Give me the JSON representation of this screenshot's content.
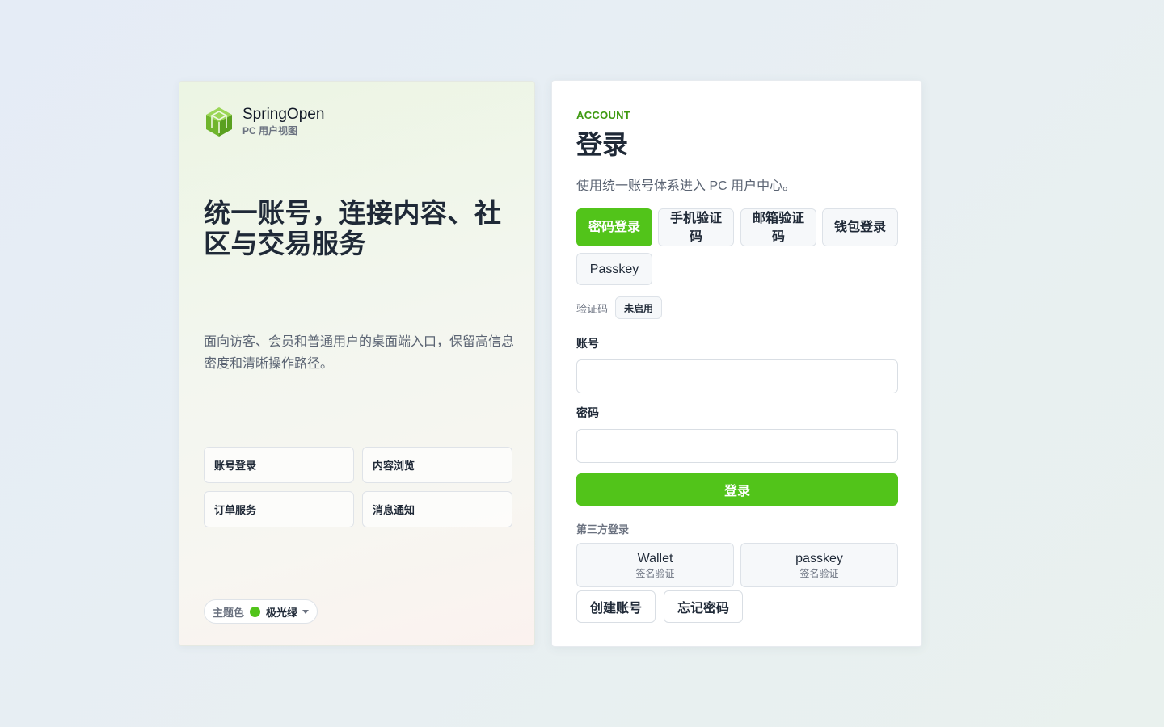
{
  "brand": {
    "name": "SpringOpen",
    "subtitle": "PC 用户视图",
    "logo_icon": "cube-box-icon",
    "logo_color": "#7cbf2f"
  },
  "hero": {
    "title": "统一账号，连接内容、社区与交易服务",
    "description": "面向访客、会员和普通用户的桌面端入口，保留高信息密度和清晰操作路径。"
  },
  "features": [
    {
      "label": "账号登录"
    },
    {
      "label": "内容浏览"
    },
    {
      "label": "订单服务"
    },
    {
      "label": "消息通知"
    }
  ],
  "theme": {
    "label": "主题色",
    "value": "极光绿",
    "color": "#52c41a"
  },
  "login": {
    "eyebrow": "ACCOUNT",
    "title": "登录",
    "subtitle": "使用统一账号体系进入 PC 用户中心。",
    "methods": [
      {
        "label": "密码登录",
        "active": true
      },
      {
        "label": "手机验证码",
        "active": false
      },
      {
        "label": "邮箱验证码",
        "active": false
      },
      {
        "label": "钱包登录",
        "active": false
      },
      {
        "label": "Passkey",
        "active": false
      }
    ],
    "captcha": {
      "label": "验证码",
      "status": "未启用"
    },
    "account": {
      "label": "账号",
      "value": "",
      "placeholder": ""
    },
    "password": {
      "label": "密码",
      "value": "",
      "placeholder": ""
    },
    "submit_label": "登录",
    "accent_color": "#52c41a",
    "third_party": {
      "title": "第三方登录",
      "providers": [
        {
          "name": "Wallet",
          "sub": "签名验证"
        },
        {
          "name": "passkey",
          "sub": "签名验证"
        }
      ]
    },
    "links": {
      "register": "创建账号",
      "forgot": "忘记密码"
    }
  }
}
